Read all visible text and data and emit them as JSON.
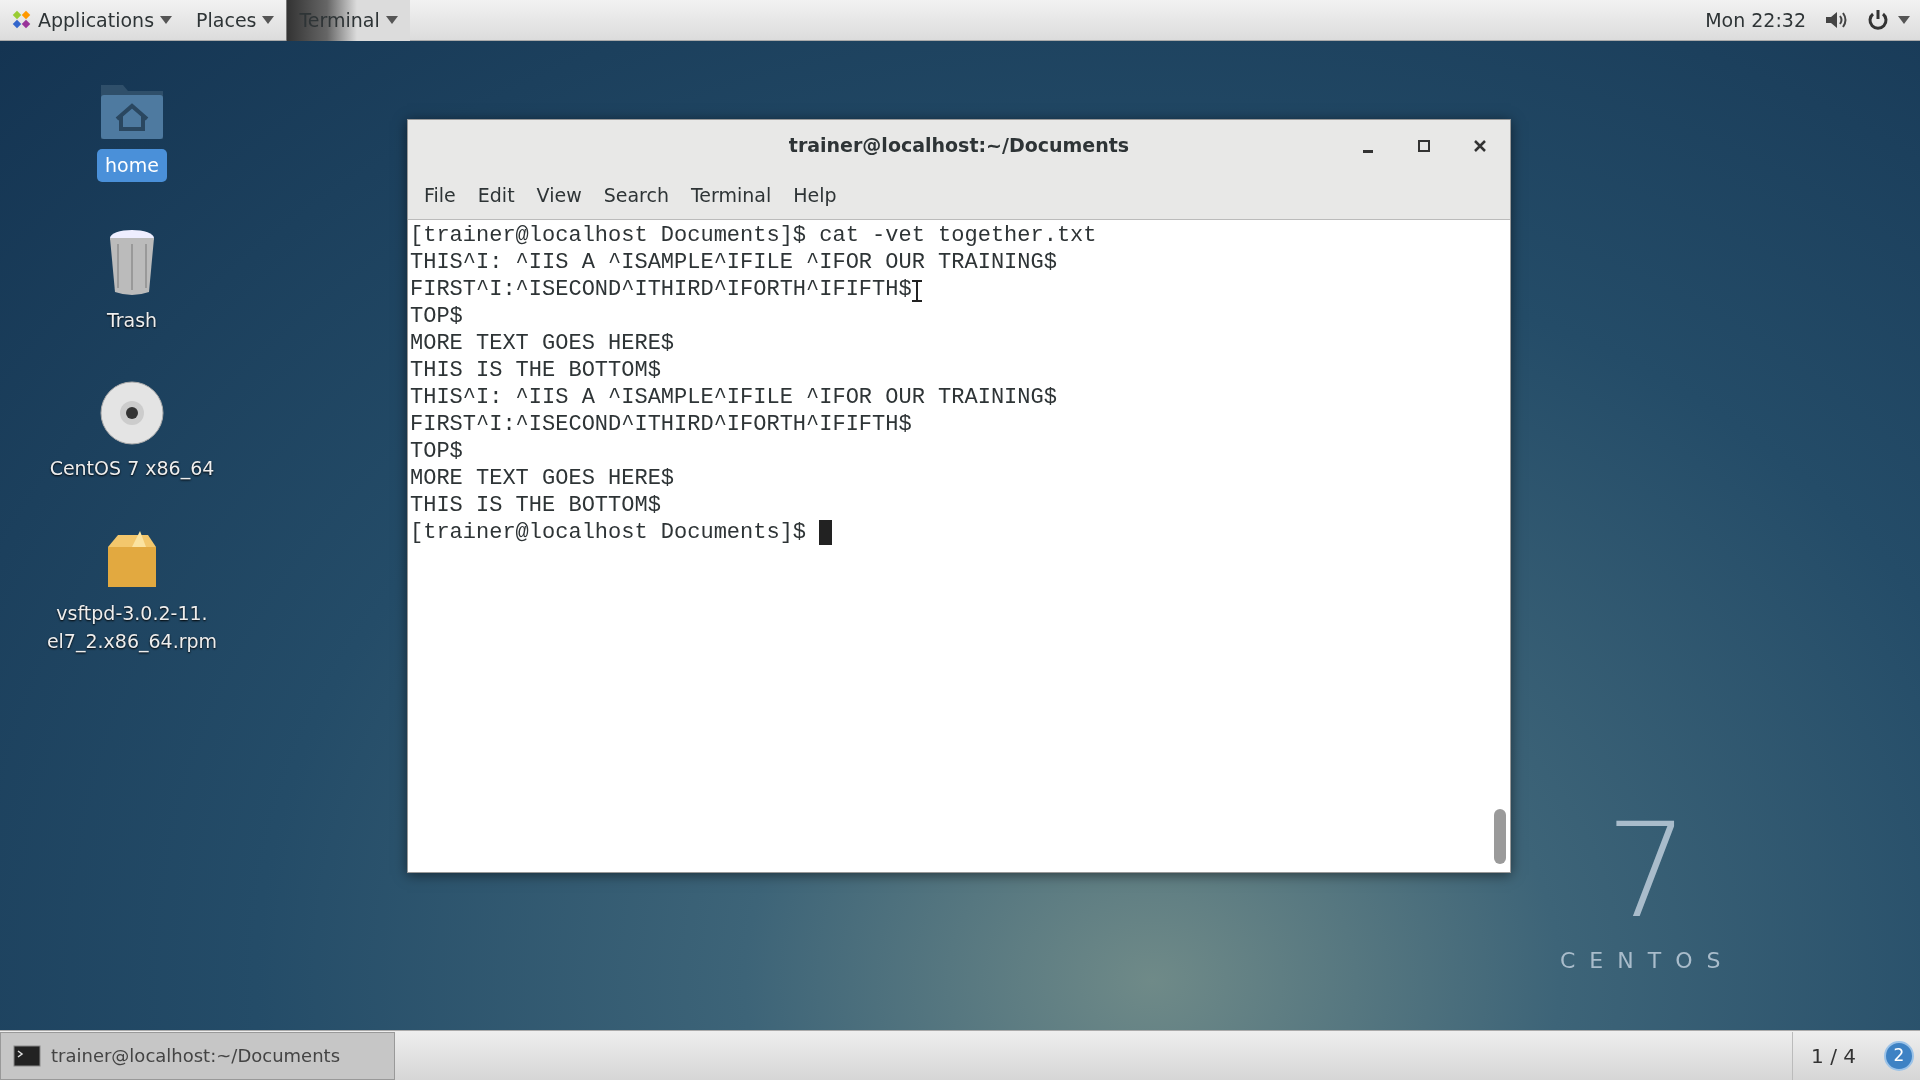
{
  "top_bar": {
    "menus": [
      {
        "label": "Applications"
      },
      {
        "label": "Places"
      }
    ],
    "task": {
      "label": "Terminal"
    },
    "clock": "Mon 22:32"
  },
  "desktop_icons": [
    {
      "kind": "folder",
      "lines": [
        "home"
      ],
      "selected": true
    },
    {
      "kind": "trash",
      "lines": [
        "Trash"
      ],
      "selected": false
    },
    {
      "kind": "disc",
      "lines": [
        "CentOS 7 x86_64"
      ],
      "selected": false
    },
    {
      "kind": "package",
      "lines": [
        "vsftpd-3.0.2-11.",
        "el7_2.x86_64.rpm"
      ],
      "selected": false
    }
  ],
  "wallpaper_logo": {
    "numeral": "7",
    "wordmark": "CENTOS"
  },
  "terminal": {
    "title": "trainer@localhost:~/Documents",
    "menu": [
      "File",
      "Edit",
      "View",
      "Search",
      "Terminal",
      "Help"
    ],
    "lines": [
      "[trainer@localhost Documents]$ cat -vet together.txt",
      "THIS^I: ^IIS A ^ISAMPLE^IFILE ^IFOR OUR TRAINING$",
      "FIRST^I:^ISECOND^ITHIRD^IFORTH^IFIFTH$",
      "TOP$",
      "MORE TEXT GOES HERE$",
      "THIS IS THE BOTTOM$",
      "THIS^I: ^IIS A ^ISAMPLE^IFILE ^IFOR OUR TRAINING$",
      "FIRST^I:^ISECOND^ITHIRD^IFORTH^IFIFTH$",
      "TOP$",
      "MORE TEXT GOES HERE$",
      "THIS IS THE BOTTOM$",
      "[trainer@localhost Documents]$ "
    ]
  },
  "taskbar": {
    "window_button": {
      "label": "trainer@localhost:~/Documents"
    },
    "workspace": "1 / 4",
    "notifications": "2"
  }
}
